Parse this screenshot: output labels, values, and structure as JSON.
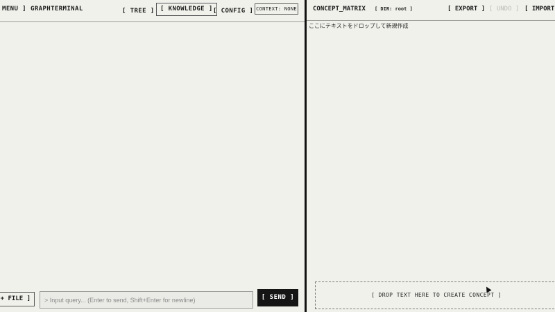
{
  "left_panel": {
    "header": {
      "menu_label": "MENU ]",
      "app_title": "GRAPHTERMINAL",
      "nav": [
        {
          "label": "[ TREE ]"
        },
        {
          "label": "[ KNOWLEDGE ]"
        },
        {
          "label": "[ CONFIG ]"
        }
      ],
      "context": "CONTEXT: NONE"
    },
    "footer": {
      "file_button": "+ FILE ]",
      "query_placeholder": "> Input query... (Enter to send, Shift+Enter for newline)",
      "send_button": "[ SEND ]"
    }
  },
  "right_panel": {
    "header": {
      "title": "CONCEPT_MATRIX",
      "dir": "[ DIR: root ]",
      "export": "[ EXPORT ]",
      "undo": "[ UNDO ]",
      "import": "[ IMPORT"
    },
    "hint": "ここにテキストをドロップして新規作成",
    "dropzone": "[ DROP TEXT HERE TO CREATE CONCEPT ]"
  }
}
